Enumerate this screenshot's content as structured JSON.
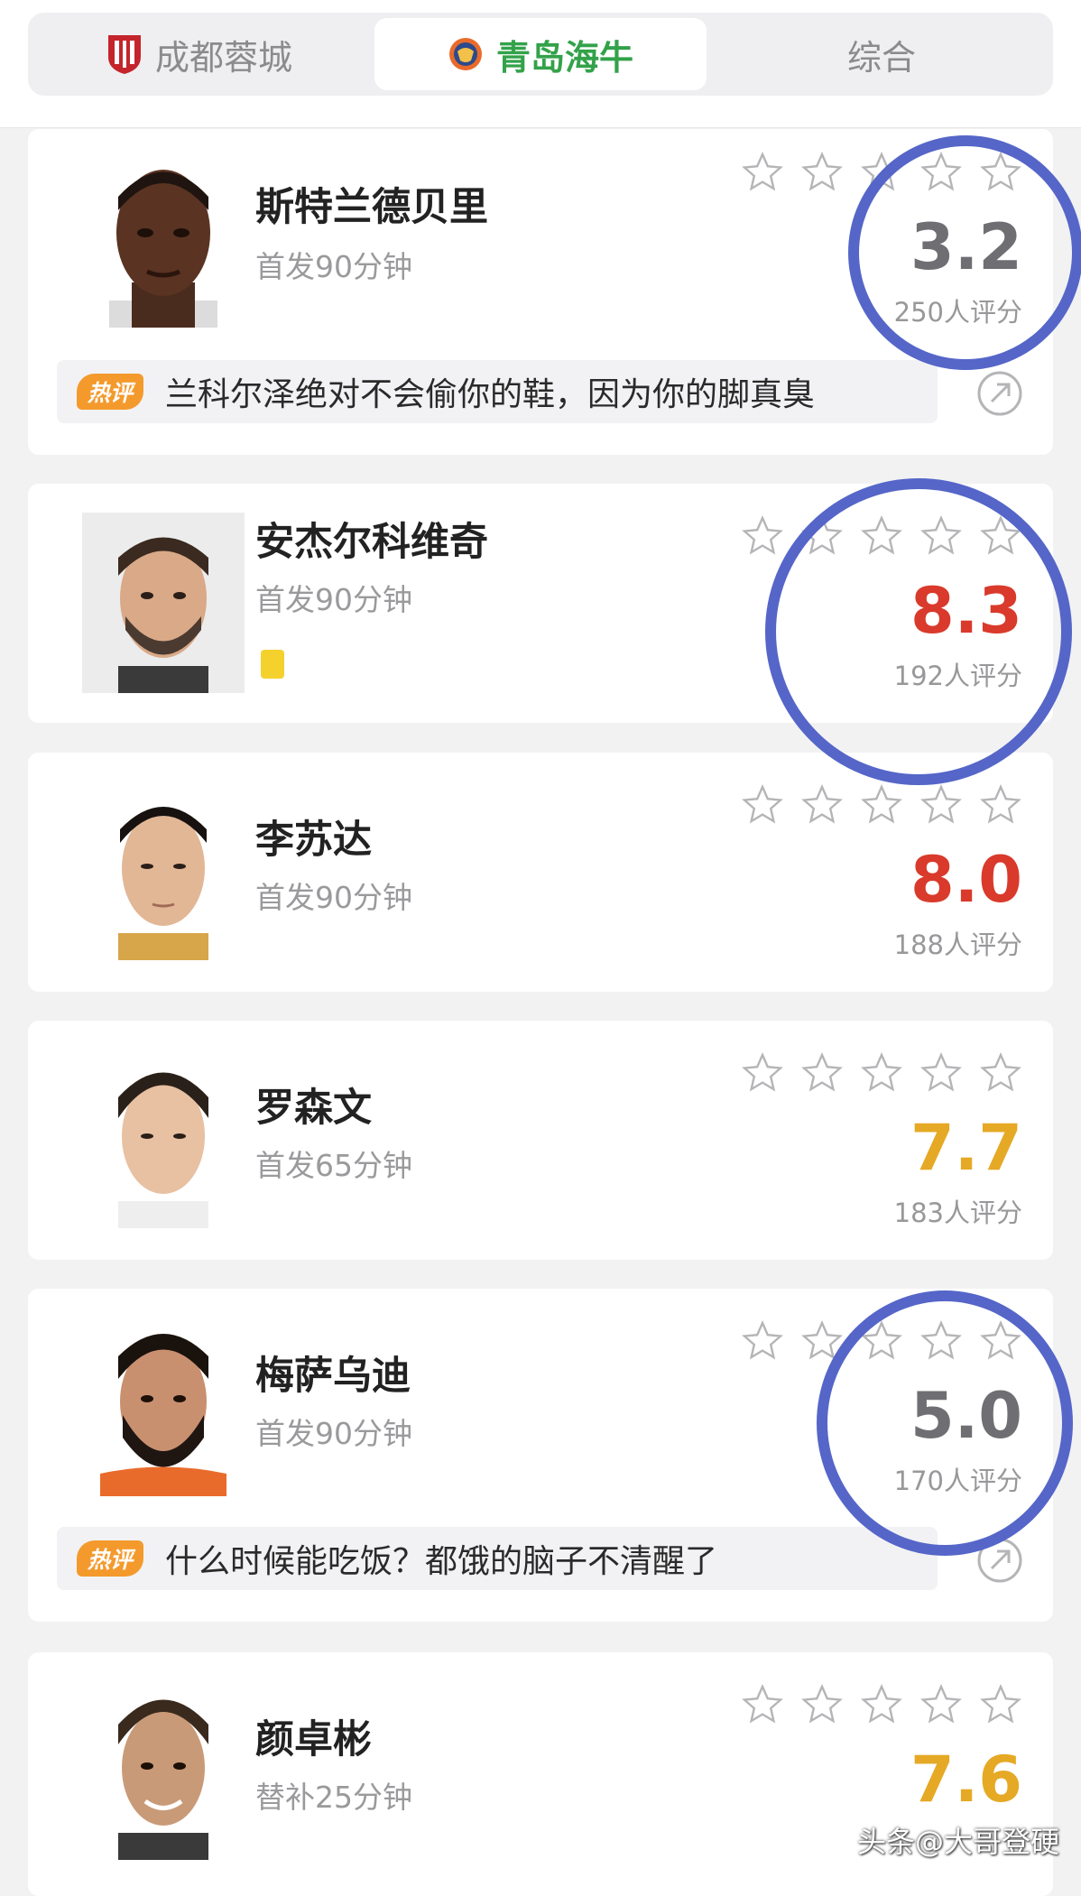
{
  "tabs": [
    {
      "label": "成都蓉城",
      "icon": "chengdu-shield-icon",
      "active": false
    },
    {
      "label": "青岛海牛",
      "icon": "qingdao-badge-icon",
      "active": true
    },
    {
      "label": "综合",
      "active": false
    }
  ],
  "colors": {
    "active_tab": "#33a24a",
    "score_red": "#d93a2b",
    "score_gold": "#e5a925",
    "score_gray": "#6f6f73",
    "annotation_circle": "#5566c8",
    "hot_badge": "#f49a2d",
    "yellow_card": "#f5d12e"
  },
  "hot_badge_label": "热评",
  "players": [
    {
      "name": "斯特兰德贝里",
      "minutes": "首发90分钟",
      "score": "3.2",
      "raters": "250人评分",
      "comment": "兰科尔泽绝对不会偷你的鞋，因为你的脚真臭",
      "yellow_card": false
    },
    {
      "name": "安杰尔科维奇",
      "minutes": "首发90分钟",
      "score": "8.3",
      "raters": "192人评分",
      "comment": "",
      "yellow_card": true
    },
    {
      "name": "李苏达",
      "minutes": "首发90分钟",
      "score": "8.0",
      "raters": "188人评分",
      "comment": "",
      "yellow_card": false
    },
    {
      "name": "罗森文",
      "minutes": "首发65分钟",
      "score": "7.7",
      "raters": "183人评分",
      "comment": "",
      "yellow_card": false
    },
    {
      "name": "梅萨乌迪",
      "minutes": "首发90分钟",
      "score": "5.0",
      "raters": "170人评分",
      "comment": "什么时候能吃饭？都饿的脑子不清醒了",
      "yellow_card": false
    },
    {
      "name": "颜卓彬",
      "minutes": "替补25分钟",
      "score": "7.6",
      "raters": "",
      "comment": "",
      "yellow_card": false
    }
  ],
  "watermark": "头条@大哥登硬"
}
